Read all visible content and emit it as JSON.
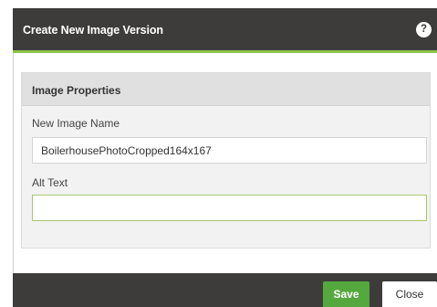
{
  "dialog": {
    "title": "Create New Image Version",
    "help_label": "?"
  },
  "panel": {
    "title": "Image Properties",
    "fields": [
      {
        "label": "New Image Name",
        "value": "BoilerhousePhotoCropped164x167"
      },
      {
        "label": "Alt Text",
        "value": ""
      }
    ]
  },
  "footer": {
    "save_label": "Save",
    "close_label": "Close"
  },
  "colors": {
    "titlebar": "#3d3c3a",
    "accent": "#8bc34a",
    "save_button": "#55a83e"
  }
}
